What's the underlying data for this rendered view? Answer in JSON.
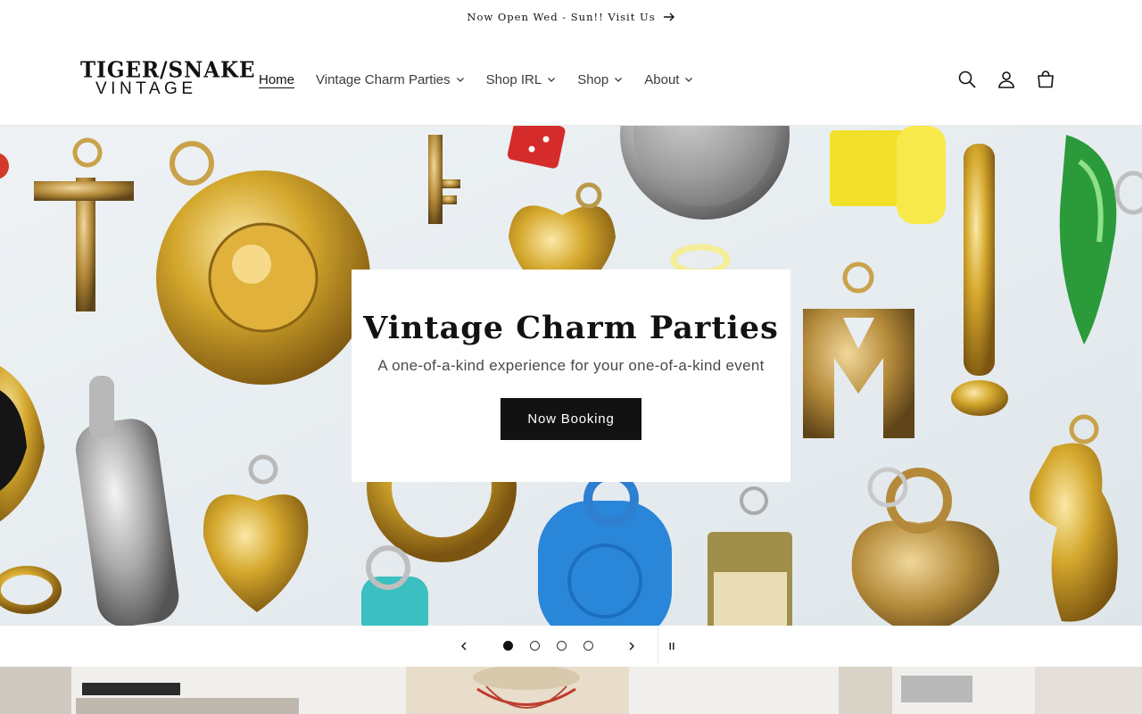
{
  "announcement": {
    "text": "Now Open Wed - Sun!! Visit Us",
    "icon": "arrow-right-icon"
  },
  "logo": {
    "line1": "TIGER/SNAKE",
    "line2": "VINTAGE"
  },
  "nav": {
    "items": [
      {
        "label": "Home",
        "active": true,
        "dropdown": false
      },
      {
        "label": "Vintage Charm Parties",
        "active": false,
        "dropdown": true
      },
      {
        "label": "Shop IRL",
        "active": false,
        "dropdown": true
      },
      {
        "label": "Shop",
        "active": false,
        "dropdown": true
      },
      {
        "label": "About",
        "active": false,
        "dropdown": true
      }
    ]
  },
  "header_icons": [
    "search-icon",
    "account-icon",
    "cart-icon"
  ],
  "hero": {
    "title": "Vintage Charm Parties",
    "subtitle": "A one-of-a-kind experience for your one-of-a-kind event",
    "button_label": "Now Booking"
  },
  "slideshow": {
    "slide_count": 4,
    "current_slide": 1,
    "controls": [
      "previous-slide-icon",
      "next-slide-icon",
      "pause-icon"
    ]
  },
  "colors": {
    "text": "#121212",
    "button_bg": "#121212",
    "button_text": "#ffffff",
    "background": "#ffffff"
  }
}
